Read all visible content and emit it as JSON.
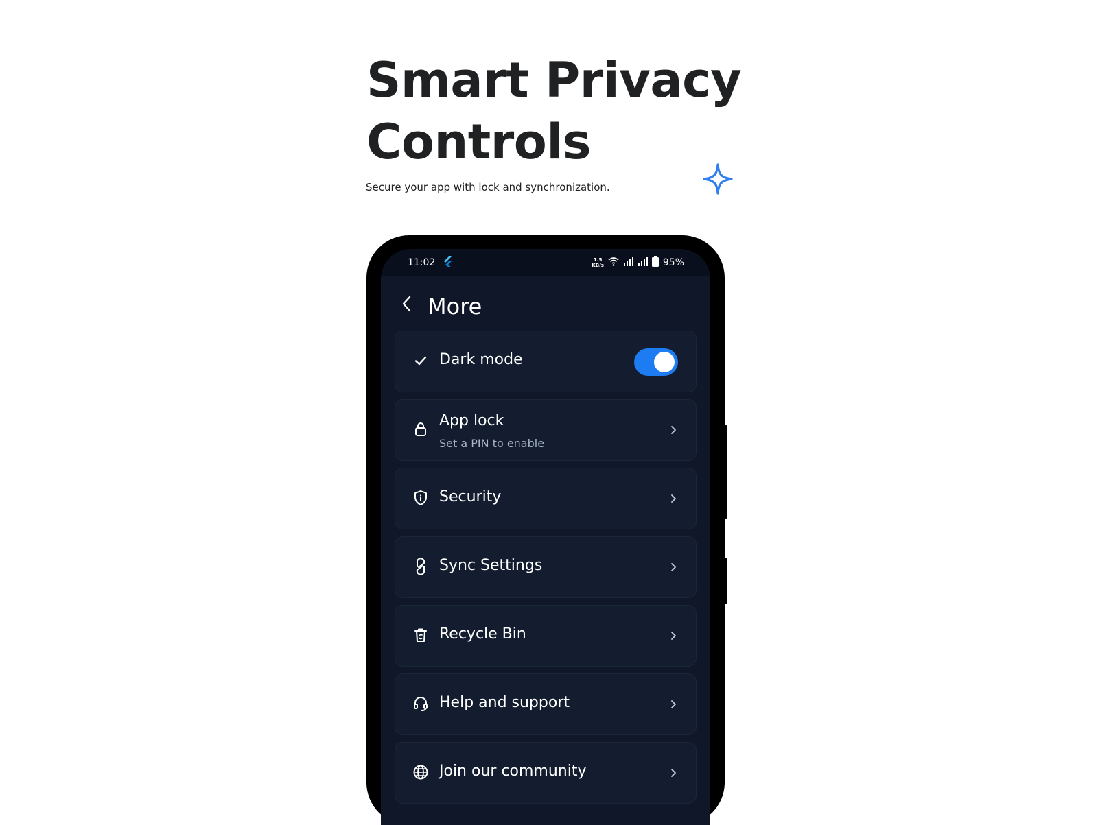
{
  "hero": {
    "title_line1": "Smart Privacy",
    "title_line2": "Controls",
    "subtitle": "Secure your app with lock and synchronization.",
    "accent_color": "#2f80ed"
  },
  "status_bar": {
    "time": "11:02",
    "net_speed_value": "1.5",
    "net_speed_unit": "KB/s",
    "battery": "95%"
  },
  "app_bar": {
    "title": "More"
  },
  "settings": {
    "dark_mode": {
      "label": "Dark mode",
      "icon": "check-icon",
      "enabled": true
    },
    "app_lock": {
      "label": "App lock",
      "sublabel": "Set a PIN to enable",
      "icon": "lock-icon"
    },
    "security": {
      "label": "Security",
      "icon": "shield-icon"
    },
    "sync": {
      "label": "Sync Settings",
      "icon": "sync-icon"
    },
    "recycle_bin": {
      "label": "Recycle Bin",
      "icon": "recycle-bin-icon"
    },
    "help": {
      "label": "Help and support",
      "icon": "headset-icon"
    },
    "community": {
      "label": "Join our community",
      "icon": "globe-icon"
    }
  },
  "colors": {
    "screen_bg": "#0f1729",
    "card_bg": "#141d2f",
    "toggle_on": "#1e7cf2"
  }
}
